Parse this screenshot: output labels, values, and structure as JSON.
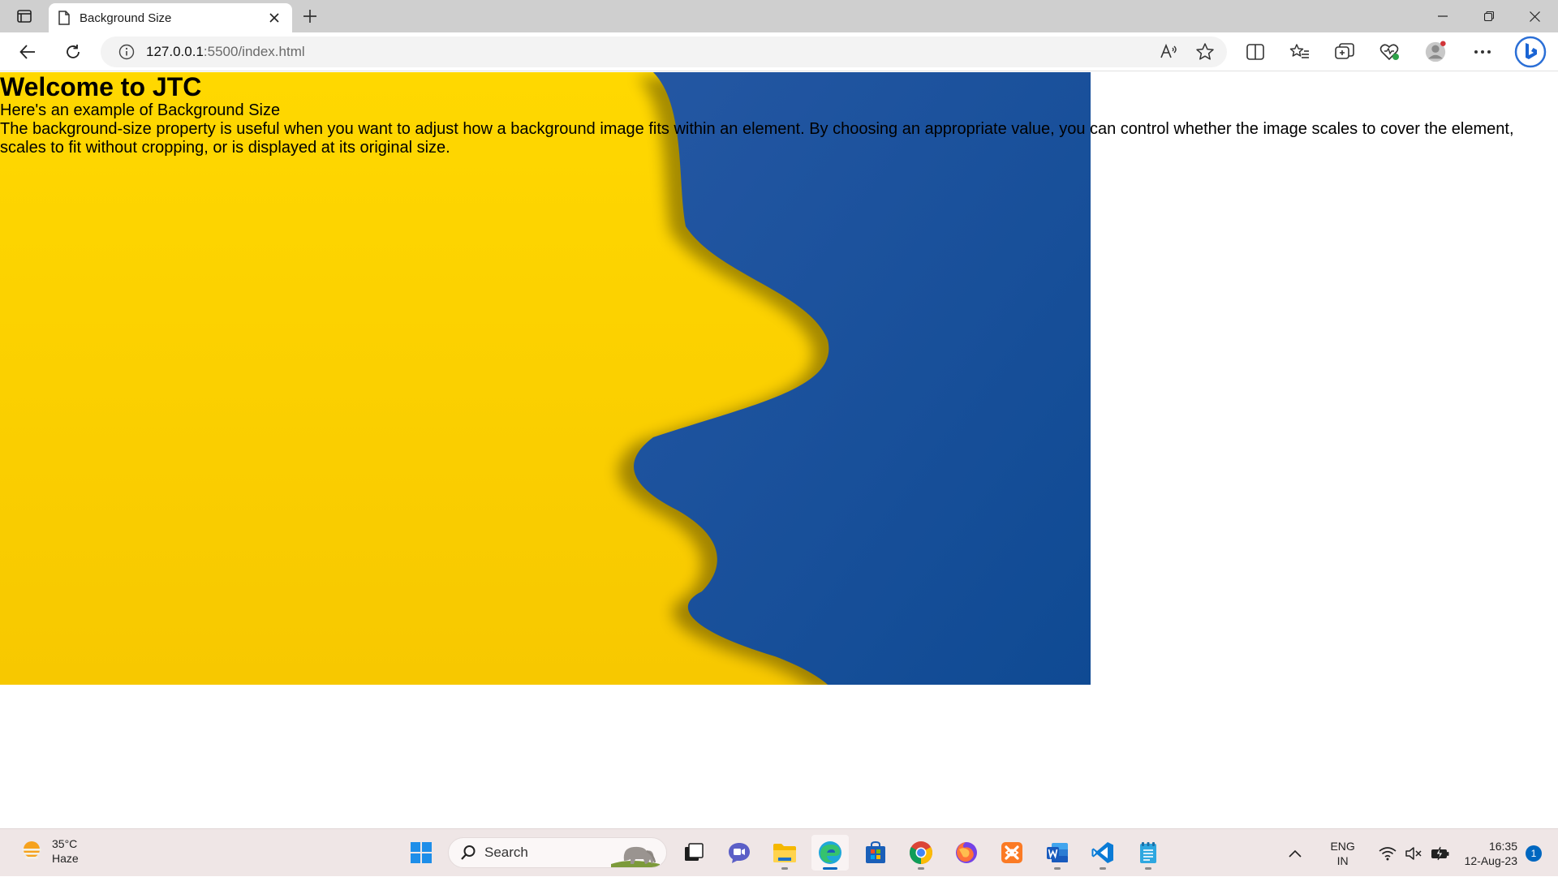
{
  "browser": {
    "tab": {
      "title": "Background Size"
    },
    "address": {
      "host": "127.0.0.1",
      "path": ":5500/index.html"
    }
  },
  "page": {
    "heading": "Welcome to JTC",
    "subtitle": "Here's an example of Background Size",
    "description": "The background-size property is useful when you want to adjust how a background image fits within an element. By choosing an appropriate value, you can control whether the image scales to cover the element, scales to fit without cropping, or is displayed at its original size.",
    "background_colors": {
      "yellow": "#ffd400",
      "blue": "#1f4e9a"
    }
  },
  "taskbar": {
    "weather": {
      "temp": "35°C",
      "condition": "Haze"
    },
    "search_label": "Search",
    "lang": {
      "line1": "ENG",
      "line2": "IN"
    },
    "clock": {
      "time": "16:35",
      "date": "12-Aug-23"
    },
    "notification_count": "1"
  },
  "colors": {
    "accent": "#0067c0",
    "chrome": "#cfcfcf"
  }
}
